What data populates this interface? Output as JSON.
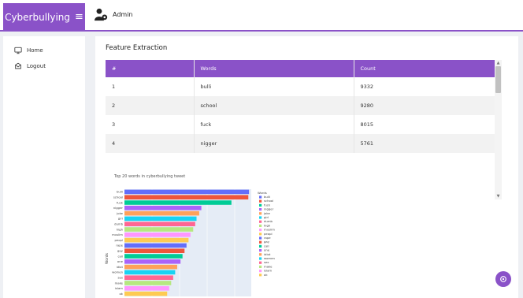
{
  "brand": {
    "title": "Cyberbullying",
    "menu_icon": "hamburger-icon"
  },
  "user": {
    "name": "Admin",
    "icon": "user-gear-icon"
  },
  "sidebar": {
    "items": [
      {
        "label": "Home",
        "icon": "monitor-icon"
      },
      {
        "label": "Logout",
        "icon": "logout-icon"
      }
    ]
  },
  "card": {
    "title": "Feature Extraction"
  },
  "table": {
    "headers": [
      "#",
      "Words",
      "Count"
    ],
    "rows": [
      [
        "1",
        "bulli",
        "9332"
      ],
      [
        "2",
        "school",
        "9280"
      ],
      [
        "3",
        "fuck",
        "8015"
      ],
      [
        "4",
        "nigger",
        "5761"
      ]
    ]
  },
  "theme": {
    "accent": "#8a52c8"
  },
  "chart_data": {
    "type": "bar",
    "orientation": "horizontal",
    "title": "Top 20 words in cyberbullying tweet",
    "ylabel": "Words",
    "legend_title": "Words",
    "legend_placement": "right",
    "categories": [
      "bulli",
      "school",
      "fuck",
      "nigger",
      "joke",
      "girl",
      "dumb",
      "high",
      "muslim",
      "peopl",
      "rape",
      "gay",
      "call",
      "one",
      "idiot",
      "women",
      "sex",
      "make",
      "islam",
      "ok"
    ],
    "values": [
      9332,
      9280,
      8015,
      5761,
      5600,
      5400,
      5300,
      5150,
      4950,
      4800,
      4650,
      4500,
      4350,
      4200,
      3950,
      3800,
      3650,
      3500,
      3350,
      3200
    ],
    "colors": [
      "#636efa",
      "#ef553b",
      "#00cc96",
      "#ab63fa",
      "#ffa15a",
      "#19d3f3",
      "#ff6692",
      "#b6e880",
      "#ff97ff",
      "#fecb52",
      "#636efa",
      "#ef553b",
      "#00cc96",
      "#ab63fa",
      "#ffa15a",
      "#19d3f3",
      "#ff6692",
      "#b6e880",
      "#ff97ff",
      "#fecb52"
    ],
    "xlim": [
      0,
      9500
    ],
    "grid": true,
    "plot_background": "#e5ecf6"
  }
}
